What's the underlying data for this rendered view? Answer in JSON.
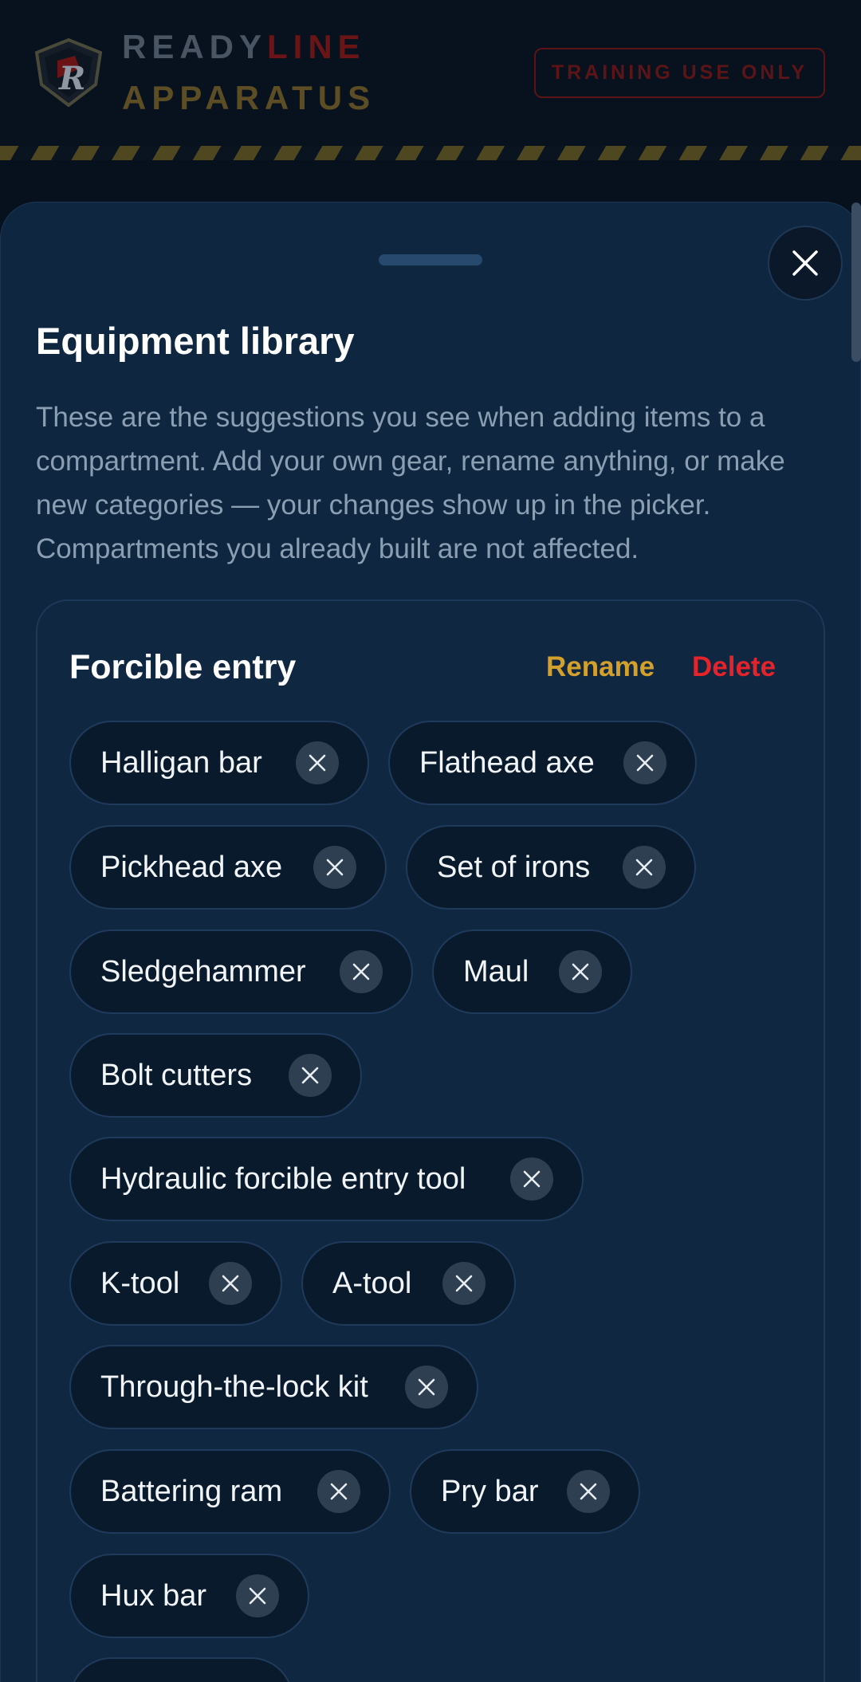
{
  "header": {
    "brand_part1": "READY",
    "brand_part2": "LINE",
    "brand_line2": "APPARATUS",
    "logo_letter": "R",
    "badge": "TRAINING USE ONLY"
  },
  "sheet": {
    "title": "Equipment library",
    "description": "These are the suggestions you see when adding items to a compartment. Add your own gear, rename anything, or make new categories — your changes show up in the picker. Compartments you already built are not affected."
  },
  "category": {
    "title": "Forcible entry",
    "rename_label": "Rename",
    "delete_label": "Delete",
    "items": [
      "Halligan bar",
      "Flathead axe",
      "Pickhead axe",
      "Set of irons",
      "Sledgehammer",
      "Maul",
      "Bolt cutters",
      "Hydraulic forcible entry tool",
      "K-tool",
      "A-tool",
      "Through-the-lock kit",
      "Battering ram",
      "Pry bar",
      "Hux bar"
    ]
  },
  "colors": {
    "accent_red": "#e5232a",
    "accent_gold": "#d4a02c",
    "sheet_bg": "#0f2640"
  },
  "icons": {
    "close": "close-icon",
    "remove": "remove-x-icon",
    "logo": "shield-logo-icon"
  }
}
